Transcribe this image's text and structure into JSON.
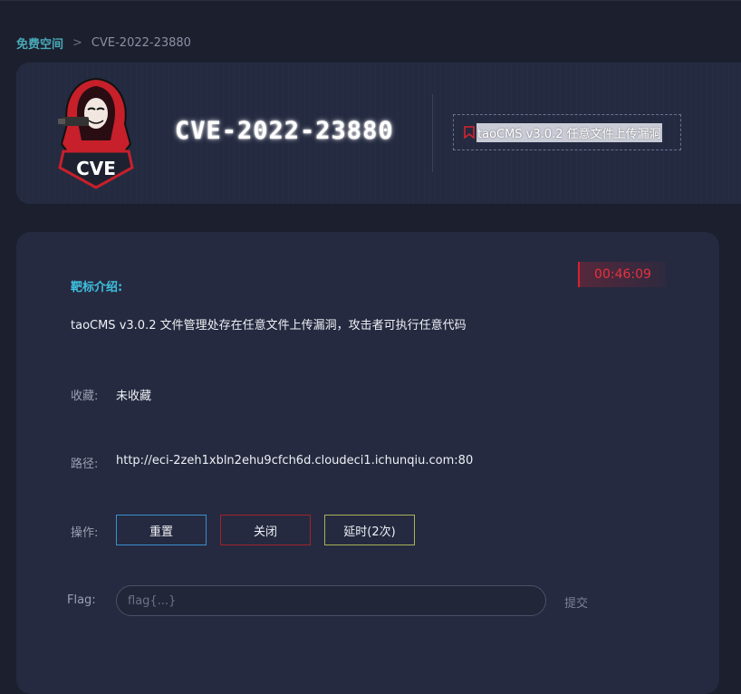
{
  "breadcrumb": {
    "parent": "免费空间",
    "separator": ">",
    "current": "CVE-2022-23880"
  },
  "header": {
    "logo_text": "CVE",
    "title": "CVE-2022-23880",
    "tag": "taoCMS v3.0.2 任意文件上传漏洞",
    "tag_icon": "bookmark-icon"
  },
  "target": {
    "timer": "00:46:09",
    "intro_label": "靶标介绍:",
    "intro_text": "taoCMS v3.0.2 文件管理处存在任意文件上传漏洞，攻击者可执行任意代码",
    "favorite_label": "收藏:",
    "favorite_value": "未收藏",
    "path_label": "路径:",
    "path_value": "http://eci-2zeh1xbln2ehu9cfch6d.cloudeci1.ichunqiu.com:80",
    "action_label": "操作:",
    "actions": {
      "reset": "重置",
      "close": "关闭",
      "extend": "延时(2次)"
    },
    "flag_label": "Flag:",
    "flag_placeholder": "flag{...}",
    "flag_value": "",
    "submit_label": "提交"
  },
  "colors": {
    "background": "#1b1f2e",
    "card": "#252a40",
    "accent_cyan": "#3fc0e0",
    "timer_red": "#e6323e",
    "reset_border": "#3a8fcf",
    "close_border": "#a3222b",
    "extend_border": "#a8b257"
  }
}
